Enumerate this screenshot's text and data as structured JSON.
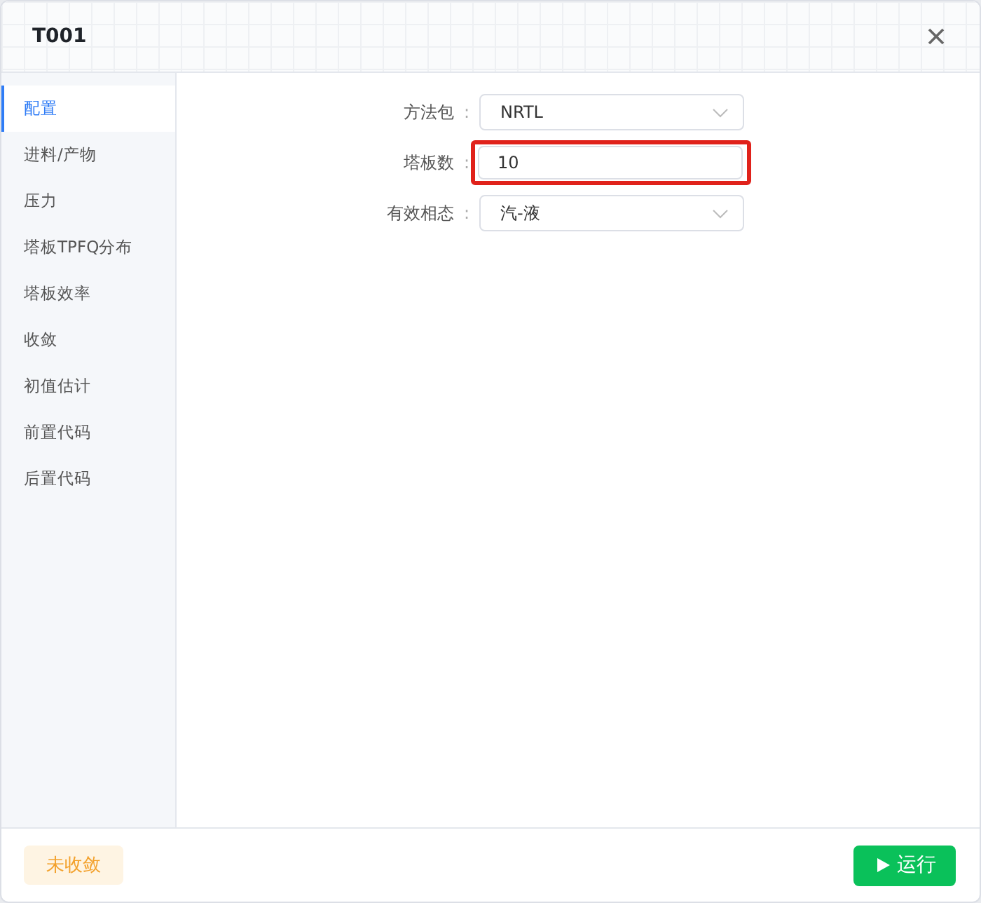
{
  "window": {
    "title": "T001"
  },
  "sidebar": {
    "items": [
      {
        "label": "配置",
        "selected": true
      },
      {
        "label": "进料/产物",
        "selected": false
      },
      {
        "label": "压力",
        "selected": false
      },
      {
        "label": "塔板TPFQ分布",
        "selected": false
      },
      {
        "label": "塔板效率",
        "selected": false
      },
      {
        "label": "收敛",
        "selected": false
      },
      {
        "label": "初值估计",
        "selected": false
      },
      {
        "label": "前置代码",
        "selected": false
      },
      {
        "label": "后置代码",
        "selected": false
      }
    ]
  },
  "form": {
    "fields": [
      {
        "label": "方法包",
        "colon": ":",
        "kind": "select",
        "value": "NRTL",
        "highlighted": false
      },
      {
        "label": "塔板数",
        "colon": ":",
        "kind": "input",
        "value": "10",
        "highlighted": true
      },
      {
        "label": "有效相态",
        "colon": ":",
        "kind": "select",
        "value": "汽-液",
        "highlighted": false
      }
    ]
  },
  "footer": {
    "status": "未收敛",
    "run_button": "运行"
  }
}
